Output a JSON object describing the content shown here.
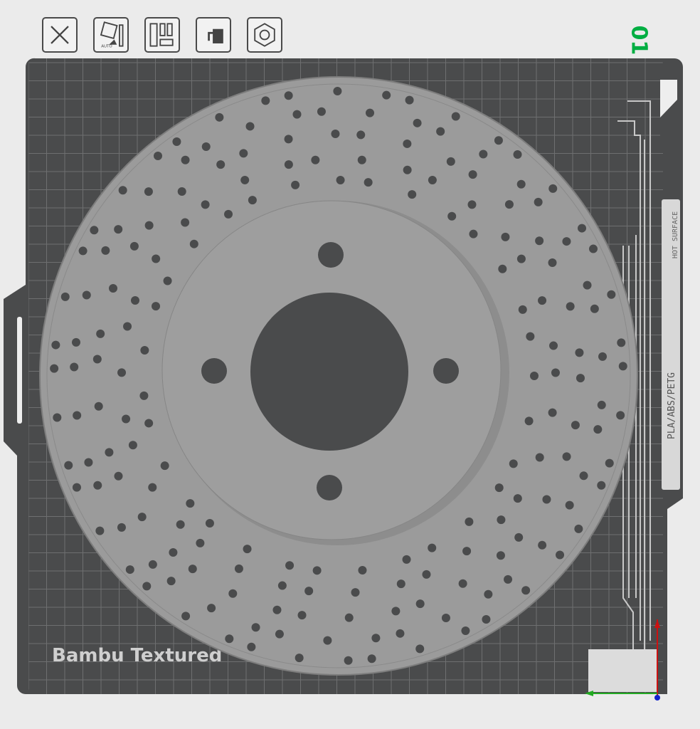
{
  "toolbar": {
    "items": [
      {
        "name": "delete-all",
        "icon": "close-icon"
      },
      {
        "name": "auto-orient",
        "icon": "auto-orient-icon",
        "badge": "AUTO"
      },
      {
        "name": "arrange",
        "icon": "arrange-icon"
      },
      {
        "name": "lock-plate",
        "icon": "lock-icon"
      },
      {
        "name": "plate-settings",
        "icon": "hex-nut-icon"
      }
    ]
  },
  "plate": {
    "number": "01",
    "label": "Bambu Textured",
    "warning": "HOT SURFACE",
    "materials": "PLA/ABS/PETG"
  },
  "colors": {
    "plate": "#4a4b4c",
    "grid": "#6e6f70",
    "model": "#9a9a9a",
    "accent": "#00ae42",
    "axis_x": "#22aa22",
    "axis_y": "#cc1111",
    "axis_z": "#1122cc"
  }
}
